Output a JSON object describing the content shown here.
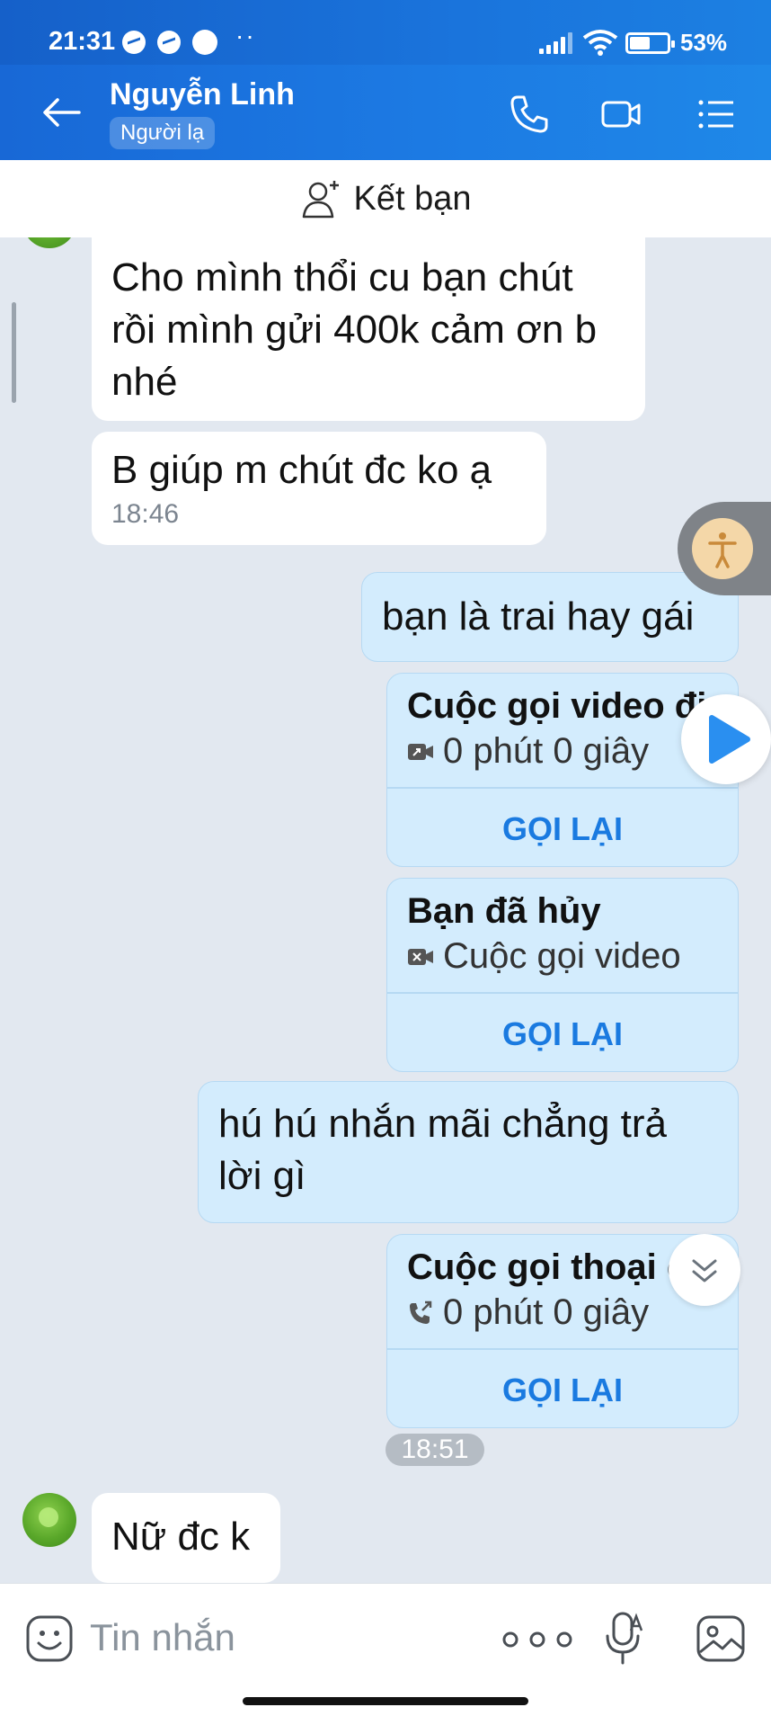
{
  "status_bar": {
    "time": "21:31",
    "battery_percent": "53%",
    "dots": "··"
  },
  "header": {
    "contact_name": "Nguyễn Linh",
    "badge": "Người lạ",
    "accent": "#1a74dc"
  },
  "add_friend": {
    "label": "Kết bạn"
  },
  "messages": [
    {
      "side": "received",
      "text": "Cho mình thổi cu bạn chút rồi mình gửi 400k cảm ơn b nhé"
    },
    {
      "side": "received",
      "text": "B giúp m chút đc ko ạ",
      "time": "18:46"
    },
    {
      "side": "sent",
      "text": "bạn là trai hay gái"
    },
    {
      "type": "call",
      "title": "Cuộc gọi video đi",
      "subtitle": "0 phút 0 giây",
      "action": "GỌI LẠI",
      "icon": "video-out-icon"
    },
    {
      "type": "call",
      "title": "Bạn đã hủy",
      "subtitle": "Cuộc gọi video",
      "action": "GỌI LẠI",
      "icon": "video-cancel-icon"
    },
    {
      "side": "sent",
      "text": "hú hú nhắn mãi chẳng trả lời gì"
    },
    {
      "type": "call",
      "title": "Cuộc gọi thoại đi",
      "subtitle": "0 phút 0 giây",
      "action": "GỌI LẠI",
      "icon": "phone-out-icon"
    },
    {
      "type": "time",
      "text": "18:51"
    },
    {
      "side": "received",
      "text": "Nữ đc k"
    }
  ],
  "input": {
    "placeholder": "Tin nhắn"
  },
  "colors": {
    "sent_bubble": "#d3ecfd",
    "received_bubble": "#ffffff",
    "chat_bg": "#e2e8f0",
    "call_again": "#1a7ae0"
  }
}
